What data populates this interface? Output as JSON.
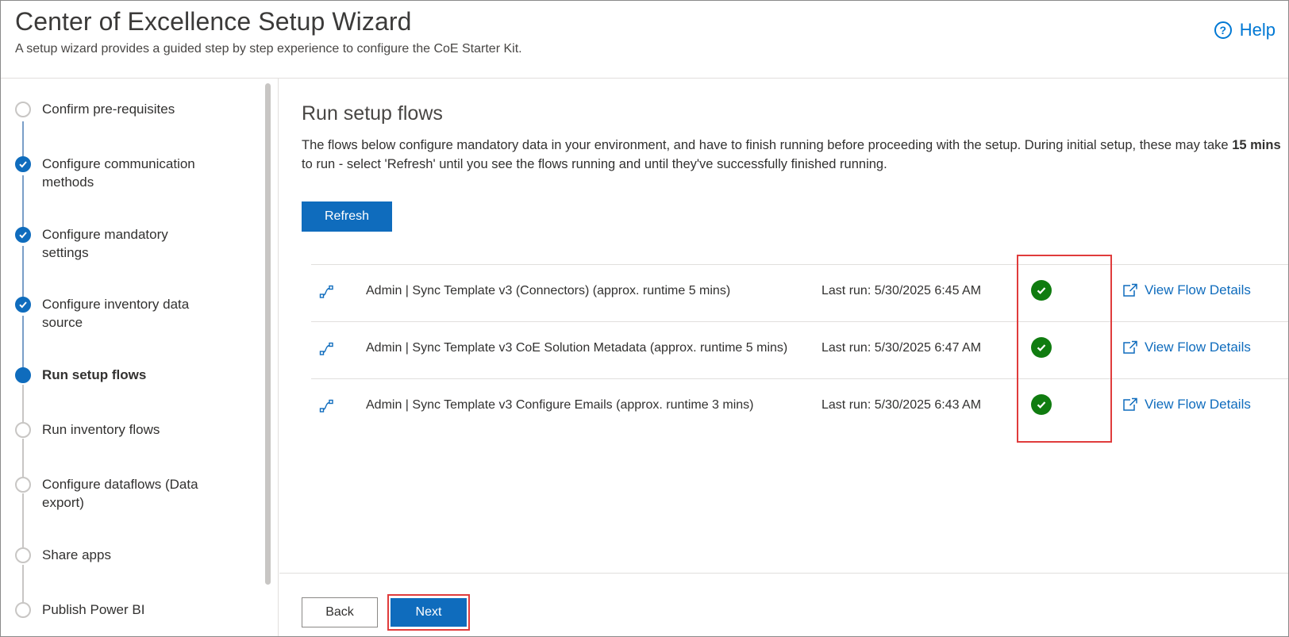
{
  "header": {
    "title": "Center of Excellence Setup Wizard",
    "subtitle": "A setup wizard provides a guided step by step experience to configure the CoE Starter Kit.",
    "help_label": "Help"
  },
  "sidebar": {
    "steps": [
      {
        "label": "Confirm pre-requisites",
        "state": "pending"
      },
      {
        "label": "Configure communication methods",
        "state": "done"
      },
      {
        "label": "Configure mandatory settings",
        "state": "done"
      },
      {
        "label": "Configure inventory data source",
        "state": "done"
      },
      {
        "label": "Run setup flows",
        "state": "current"
      },
      {
        "label": "Run inventory flows",
        "state": "pending"
      },
      {
        "label": "Configure dataflows (Data export)",
        "state": "pending"
      },
      {
        "label": "Share apps",
        "state": "pending"
      },
      {
        "label": "Publish Power BI",
        "state": "pending"
      }
    ]
  },
  "main": {
    "title": "Run setup flows",
    "description_part1": "The flows below configure mandatory data in your environment, and have to finish running before proceeding with the setup. During initial setup, these may take ",
    "description_bold": "15 mins",
    "description_part2": " to run - select 'Refresh' until you see the flows running and until they've successfully finished running.",
    "refresh_label": "Refresh",
    "flows": [
      {
        "name": "Admin | Sync Template v3 (Connectors) (approx. runtime 5 mins)",
        "last_run": "Last run: 5/30/2025 6:45 AM",
        "status": "success",
        "link_label": "View Flow Details"
      },
      {
        "name": "Admin | Sync Template v3 CoE Solution Metadata (approx. runtime 5 mins)",
        "last_run": "Last run: 5/30/2025 6:47 AM",
        "status": "success",
        "link_label": "View Flow Details"
      },
      {
        "name": "Admin | Sync Template v3 Configure Emails (approx. runtime 3 mins)",
        "last_run": "Last run: 5/30/2025 6:43 AM",
        "status": "success",
        "link_label": "View Flow Details"
      }
    ],
    "back_label": "Back",
    "next_label": "Next"
  },
  "colors": {
    "accent": "#0f6cbd",
    "success": "#107c10",
    "highlight": "#e03c3c"
  }
}
